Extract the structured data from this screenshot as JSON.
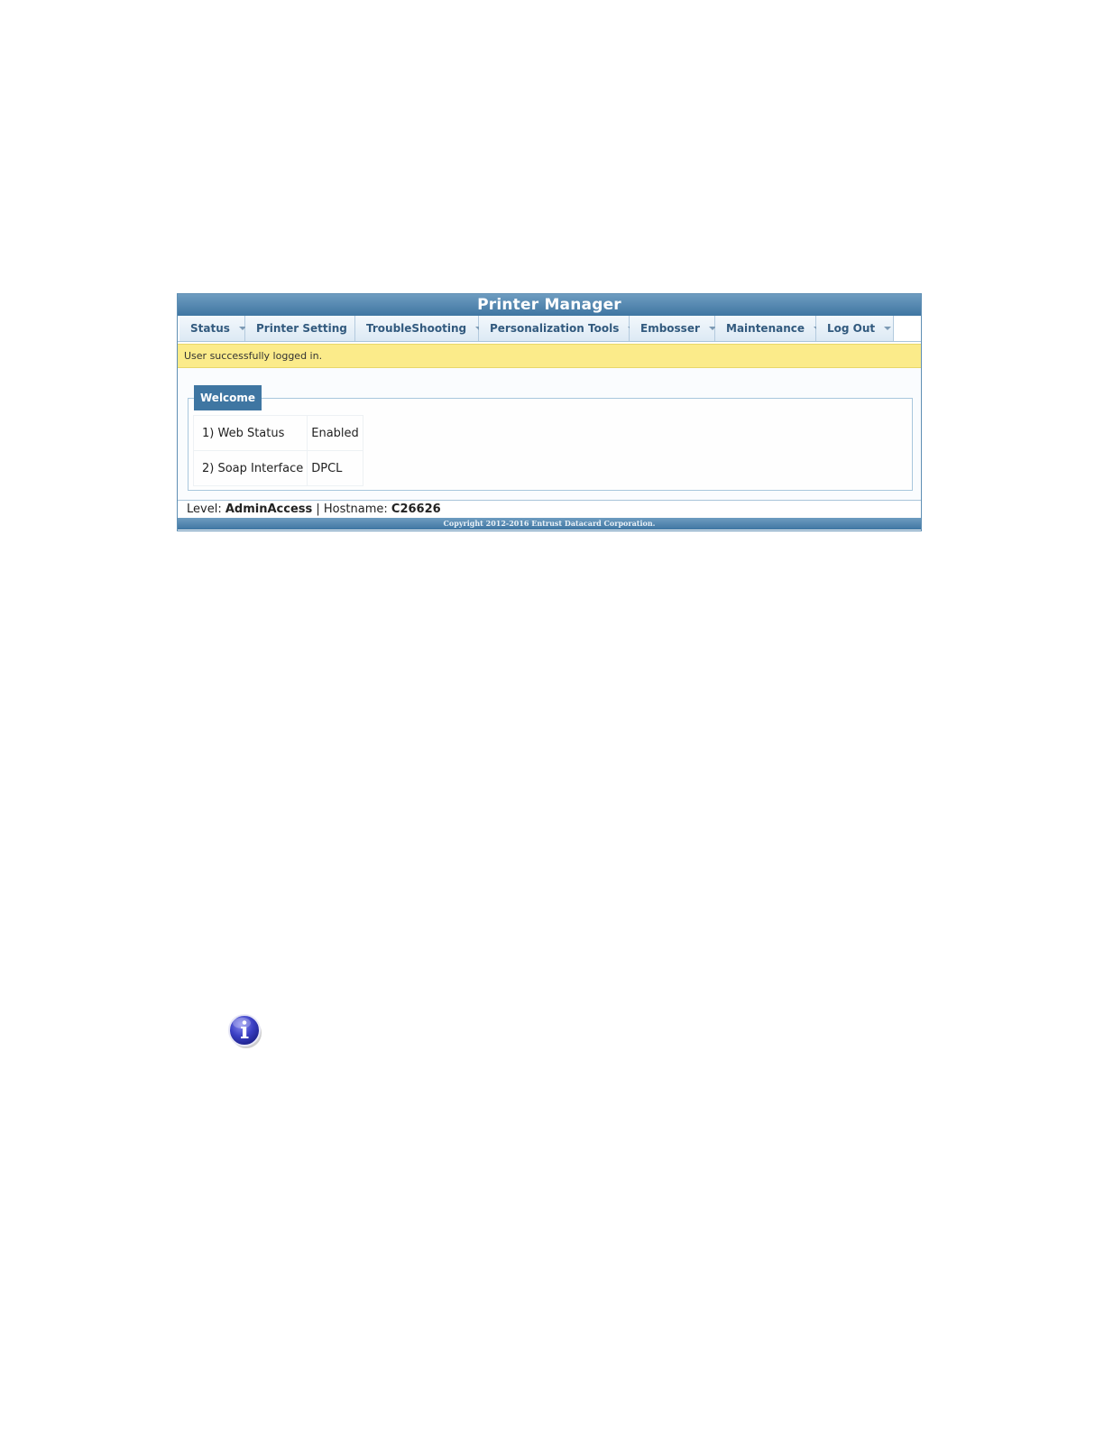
{
  "app": {
    "title": "Printer Manager"
  },
  "menu": {
    "items": [
      {
        "label": "Status"
      },
      {
        "label": "Printer Setting"
      },
      {
        "label": "TroubleShooting"
      },
      {
        "label": "Personalization Tools"
      },
      {
        "label": "Embosser"
      },
      {
        "label": "Maintenance"
      },
      {
        "label": "Log Out"
      }
    ]
  },
  "message": "User successfully logged in.",
  "welcome": {
    "legend": "Welcome",
    "rows": [
      {
        "label": "1) Web Status",
        "value": "Enabled"
      },
      {
        "label": "2) Soap Interface",
        "value": "DPCL"
      }
    ]
  },
  "status_bar": {
    "level_label": "Level:",
    "level_value": "AdminAccess",
    "separator": "|",
    "hostname_label": "Hostname:",
    "hostname_value": "C26626"
  },
  "footer": {
    "copyright": "Copyright 2012-2016 Entrust Datacard Corporation."
  },
  "icons": {
    "menu_caret": "chevron-down-icon",
    "note": "info-icon"
  },
  "colors": {
    "header_blue": "#3f76a2",
    "message_yellow": "#fbeb8a",
    "menu_text": "#325a7e"
  }
}
